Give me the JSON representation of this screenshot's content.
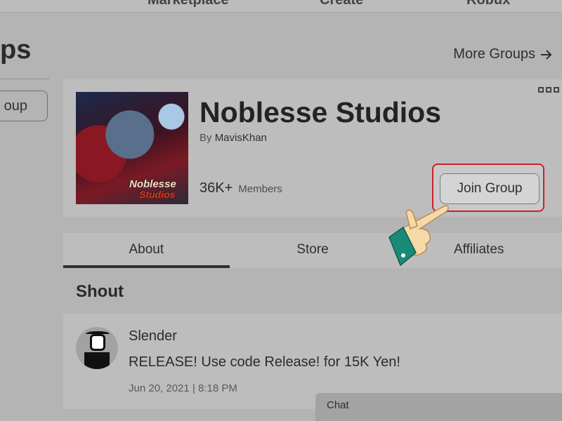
{
  "topnav": {
    "items": [
      "Marketplace",
      "Create",
      "Robux"
    ]
  },
  "page": {
    "heading_fragment": "ps",
    "create_fragment": "oup"
  },
  "more_groups_label": "More Groups",
  "group": {
    "name": "Noblesse Studios",
    "by_prefix": "By",
    "owner": "MavisKhan",
    "member_count": "36K+",
    "members_label": "Members",
    "join_label": "Join Group",
    "thumb_logo_line1": "Noblesse",
    "thumb_logo_line2": "Studios"
  },
  "tabs": [
    {
      "label": "About",
      "active": true
    },
    {
      "label": "Store",
      "active": false
    },
    {
      "label": "Affiliates",
      "active": false
    }
  ],
  "shout": {
    "title": "Shout",
    "user": "Slender",
    "message": "RELEASE! Use code Release! for 15K Yen!",
    "timestamp": "Jun 20, 2021 | 8:18 PM"
  },
  "chat": {
    "label": "Chat"
  },
  "colors": {
    "highlight_border": "#cf1e2b",
    "cuff": "#1a8a78",
    "hand": "#f6d9a8"
  }
}
